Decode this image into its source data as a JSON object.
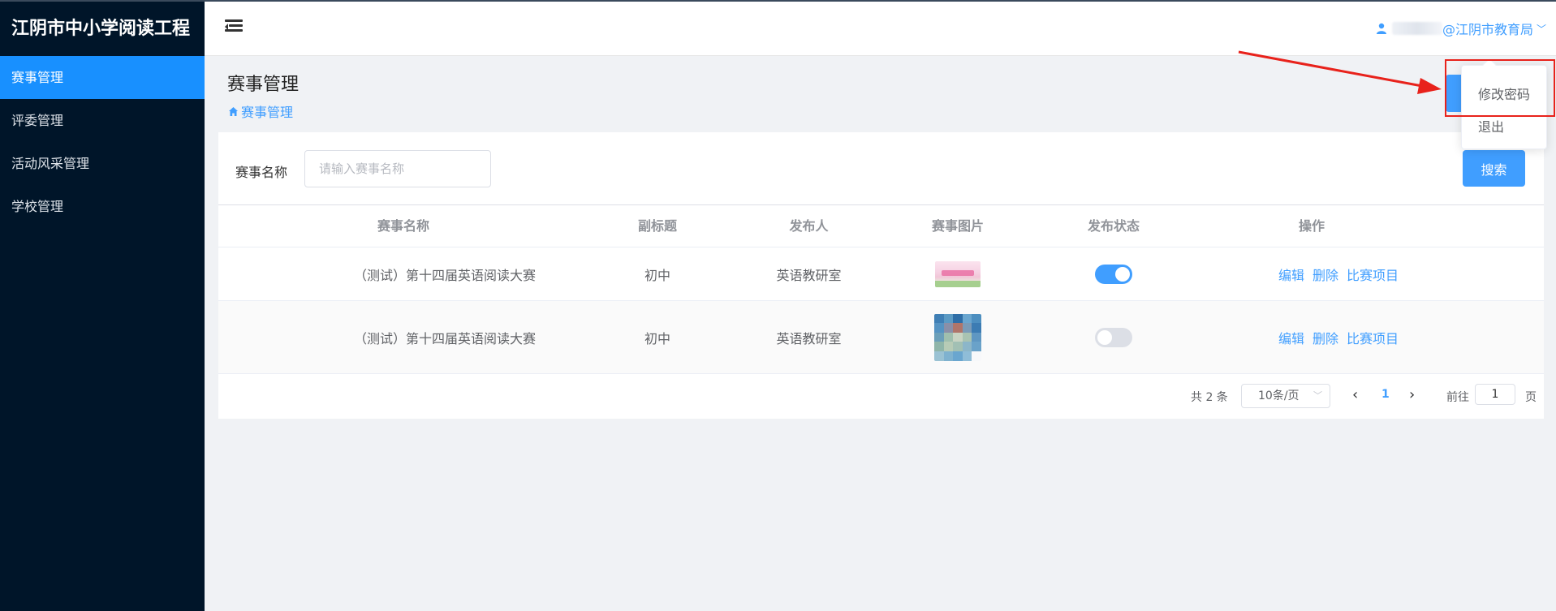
{
  "app": {
    "title": "江阴市中小学阅读工程"
  },
  "sidebar": {
    "items": [
      {
        "label": "赛事管理",
        "active": true
      },
      {
        "label": "评委管理"
      },
      {
        "label": "活动风采管理"
      },
      {
        "label": "学校管理"
      }
    ]
  },
  "header": {
    "user_suffix": "@江阴市教育局",
    "icons": {
      "menu": "hamburger-icon",
      "user": "user-icon",
      "dropdown": "chevron-down-icon"
    }
  },
  "page": {
    "title": "赛事管理",
    "breadcrumb": "赛事管理"
  },
  "search": {
    "label": "赛事名称",
    "placeholder": "请输入赛事名称",
    "value": "",
    "button": "搜索"
  },
  "table": {
    "headers": [
      "赛事名称",
      "副标题",
      "发布人",
      "赛事图片",
      "发布状态",
      "操作"
    ],
    "rows": [
      {
        "name": "（测试）第十四届英语阅读大赛",
        "subtitle": "初中",
        "publisher": "英语教研室",
        "published": true
      },
      {
        "name": "（测试）第十四届英语阅读大赛",
        "subtitle": "初中",
        "publisher": "英语教研室",
        "published": false
      }
    ],
    "actions": [
      "编辑",
      "删除",
      "比赛项目"
    ]
  },
  "pagination": {
    "total": "共 2 条",
    "page_size": "10条/页",
    "current_page": "1",
    "goto_label": "前往",
    "goto_value": "1",
    "page_suffix": "页"
  },
  "dropdown": {
    "items": [
      "修改密码",
      "退出"
    ]
  },
  "colors": {
    "sidebar_bg": "#001529",
    "primary": "#409eff",
    "active_menu": "#1890ff",
    "annotation": "#e8221b"
  }
}
